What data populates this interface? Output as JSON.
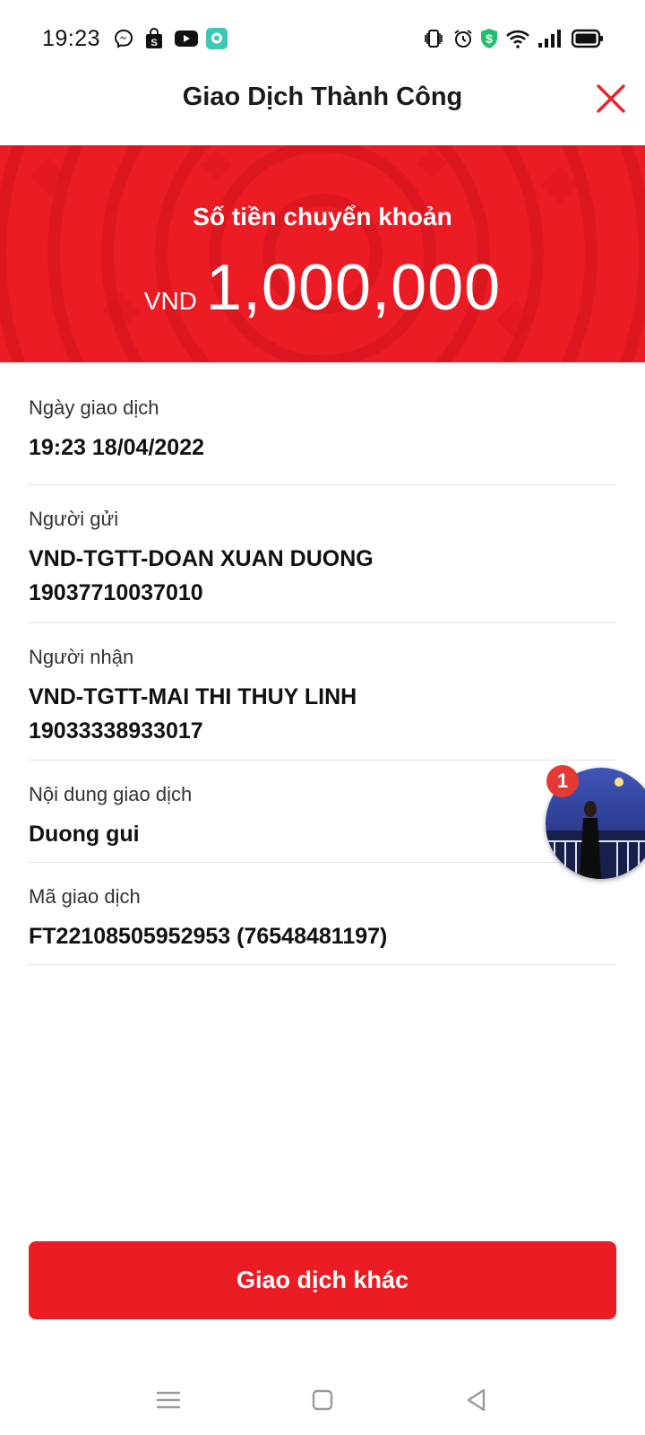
{
  "status_bar": {
    "time": "19:23",
    "left_icons": [
      "messenger-icon",
      "shopping-bag-icon",
      "youtube-icon",
      "chat-app-icon"
    ],
    "right_icons": [
      "vibrate-icon",
      "alarm-icon",
      "dollar-shield-icon",
      "wifi-icon",
      "signal-icon",
      "battery-icon"
    ]
  },
  "header": {
    "title": "Giao Dịch Thành Công",
    "close_icon": "close-icon"
  },
  "banner": {
    "label": "Số tiền chuyển khoản",
    "currency": "VND",
    "amount": "1,000,000"
  },
  "details": {
    "date": {
      "label": "Ngày giao dịch",
      "value": "19:23 18/04/2022"
    },
    "sender": {
      "label": "Người gửi",
      "name": "VND-TGTT-DOAN XUAN DUONG",
      "account": "19037710037010"
    },
    "receiver": {
      "label": "Người nhận",
      "name": "VND-TGTT-MAI THI THUY LINH",
      "account": "19033338933017"
    },
    "content": {
      "label": "Nội dung giao dịch",
      "value": "Duong gui"
    },
    "code": {
      "label": "Mã giao dịch",
      "value": "FT22108505952953 (76548481197)"
    }
  },
  "chat_head": {
    "badge": "1"
  },
  "action_button": {
    "label": "Giao dịch khác"
  },
  "nav_bar": {
    "icons": [
      "menu-icon",
      "home-square-icon",
      "back-triangle-icon"
    ]
  },
  "colors": {
    "brand_red": "#ec1c24",
    "badge_red": "#e53935"
  }
}
